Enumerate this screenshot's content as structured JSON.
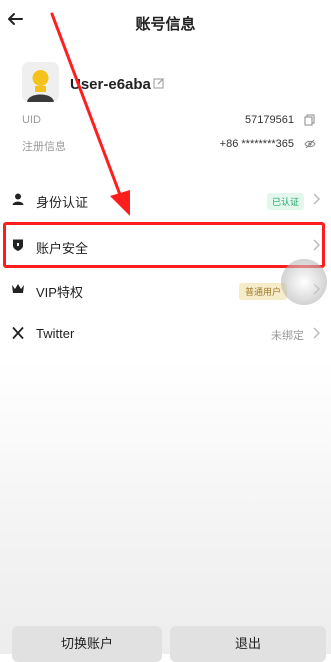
{
  "header": {
    "title": "账号信息"
  },
  "profile": {
    "username": "User-e6aba"
  },
  "info": [
    {
      "label": "UID",
      "value": "57179561"
    },
    {
      "label": "注册信息",
      "value": "+86 ********365"
    }
  ],
  "menu": {
    "identity": {
      "label": "身份认证",
      "badge": "已认证"
    },
    "security": {
      "label": "账户安全"
    },
    "vip": {
      "label": "VIP特权",
      "badge": "普通用户"
    },
    "twitter": {
      "label": "Twitter",
      "value": "未绑定"
    }
  },
  "footer": {
    "switch_label": "切换账户",
    "logout_label": "退出"
  },
  "colors": {
    "highlight": "#ff1e1e",
    "accent_green": "#22a86b"
  }
}
